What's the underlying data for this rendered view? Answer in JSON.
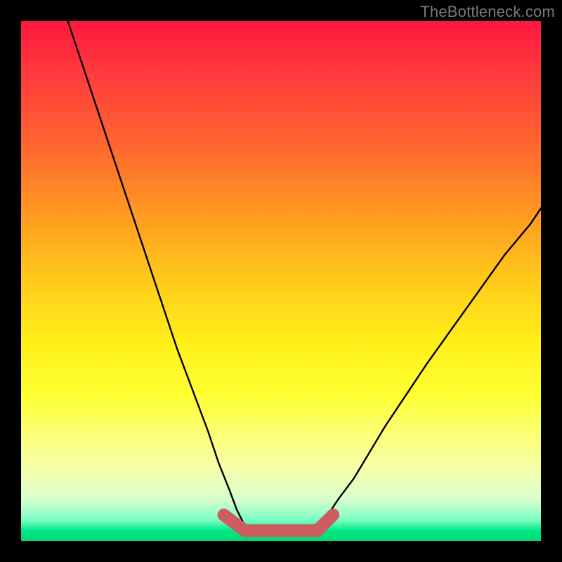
{
  "watermark": "TheBottleneck.com",
  "chart_data": {
    "type": "line",
    "title": "",
    "xlabel": "",
    "ylabel": "",
    "xlim": [
      0,
      100
    ],
    "ylim": [
      0,
      100
    ],
    "series": [
      {
        "name": "curve-left",
        "x": [
          9,
          12,
          15,
          18,
          21,
          24,
          27,
          30,
          33,
          36,
          38,
          40,
          41.5,
          43
        ],
        "y": [
          100,
          91,
          82,
          73,
          64,
          55,
          46,
          37,
          29,
          21,
          15,
          10,
          6,
          3
        ]
      },
      {
        "name": "curve-right",
        "x": [
          57,
          59,
          61,
          64,
          67,
          70,
          74,
          78,
          83,
          88,
          93,
          98,
          100
        ],
        "y": [
          3,
          5,
          8,
          12,
          17,
          22,
          28,
          34,
          41,
          48,
          55,
          61,
          64
        ]
      },
      {
        "name": "bottom-band",
        "x": [
          39,
          43,
          46,
          50,
          54,
          57,
          60
        ],
        "y": [
          5,
          2,
          2,
          2,
          2,
          2,
          5
        ]
      }
    ],
    "colors": {
      "curve": "#000000",
      "band": "#cf5b62"
    }
  }
}
